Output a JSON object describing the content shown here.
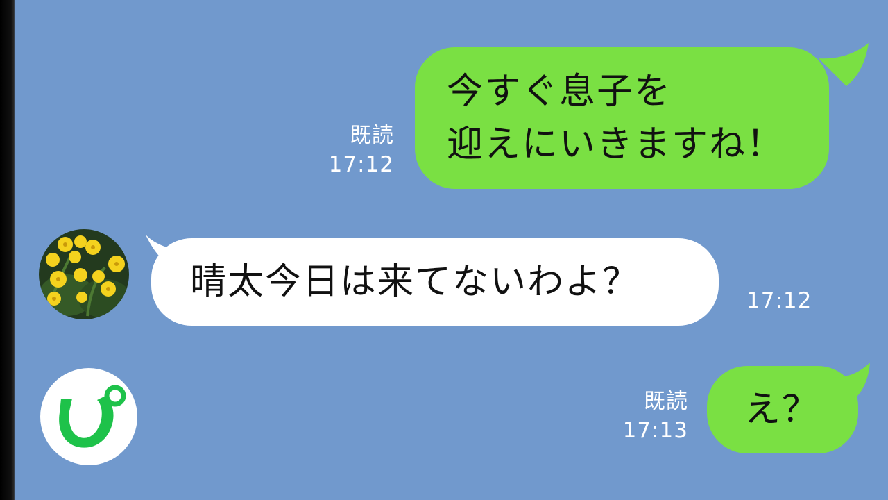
{
  "chat": {
    "messages": [
      {
        "side": "sent",
        "lines": [
          "今すぐ息子を",
          "迎えにいきますね！"
        ],
        "read_label": "既読",
        "time": "17:12"
      },
      {
        "side": "received",
        "lines": [
          "晴太今日は来てないわよ？"
        ],
        "time": "17:12",
        "avatar": "yellow-flowers-avatar"
      },
      {
        "side": "sent",
        "lines": [
          "え？"
        ],
        "read_label": "既読",
        "time": "17:13"
      }
    ]
  },
  "logo": {
    "text": "ぴ",
    "icon": "pi-logo-icon"
  },
  "colors": {
    "background": "#7199cd",
    "sent_bubble": "#7ae043",
    "received_bubble": "#ffffff",
    "meta_text": "#ffffff",
    "logo_green": "#1ec24a"
  }
}
